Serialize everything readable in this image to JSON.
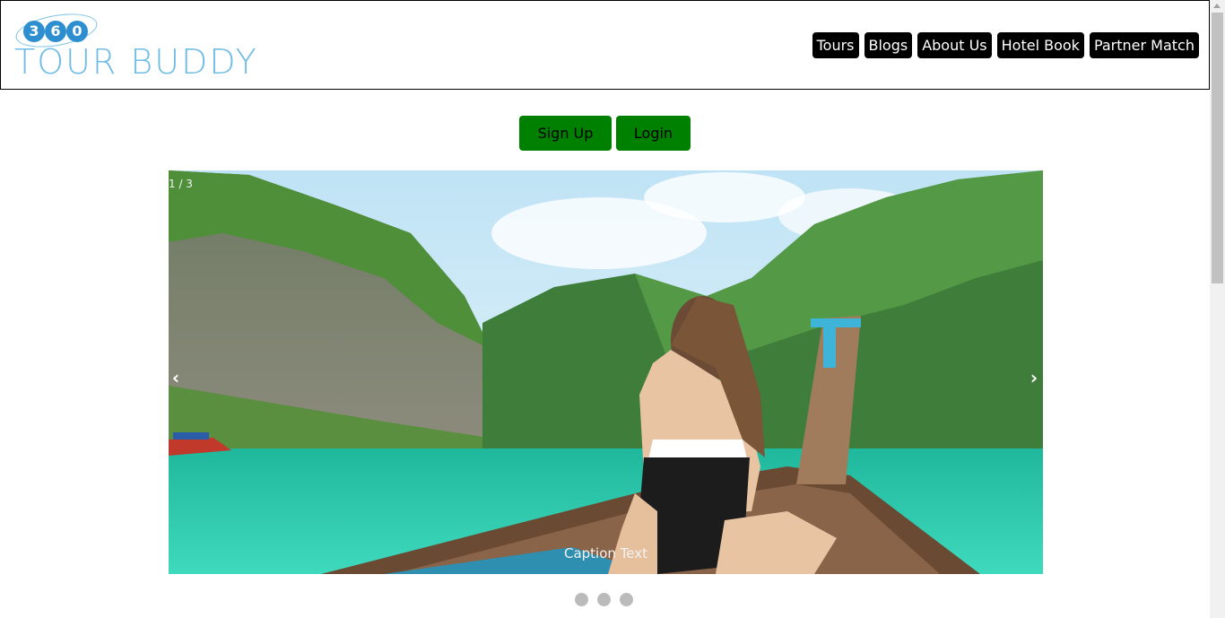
{
  "brand": {
    "logo_digits": [
      "3",
      "6",
      "0"
    ],
    "logo_text": "TOUR BUDDY",
    "logo_color": "#6fbde6",
    "digit_color": "#2d8fd0"
  },
  "nav": {
    "items": [
      {
        "label": "Tours"
      },
      {
        "label": "Blogs"
      },
      {
        "label": "About Us"
      },
      {
        "label": "Hotel Book"
      },
      {
        "label": "Partner Match"
      }
    ],
    "button_color": "#000000"
  },
  "auth": {
    "signup_label": "Sign Up",
    "login_label": "Login",
    "button_color": "#008000"
  },
  "slideshow": {
    "counter": "1 / 3",
    "caption": "Caption Text",
    "prev_icon": "‹",
    "next_icon": "›",
    "dot_count": 3,
    "image_description_icon": "tropical-lagoon-boat-photo"
  }
}
